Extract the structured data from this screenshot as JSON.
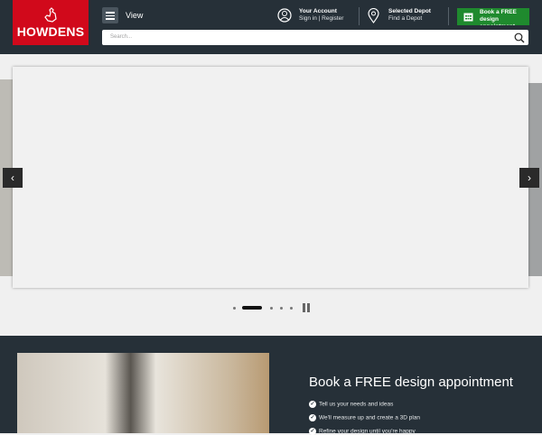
{
  "header": {
    "logo": "HOWDENS",
    "menu_label": "View",
    "account_title": "Your Account",
    "account_sub": "Sign in | Register",
    "depot_title": "Selected Depot",
    "depot_sub": "Find a Depot",
    "book_label": "Book a FREE design appointment",
    "search_placeholder": "Search..."
  },
  "carousel": {
    "slide_count": 5,
    "active_index": 1,
    "prev": "‹",
    "next": "›"
  },
  "promo": {
    "title": "Book a FREE design appointment",
    "items": [
      "Tell us your needs and ideas",
      "We'll measure up and create a 3D plan",
      "Refine your design until you're happy"
    ]
  },
  "colors": {
    "brand_red": "#d1091b",
    "header_bg": "#263038",
    "book_green": "#1f8a2e"
  }
}
